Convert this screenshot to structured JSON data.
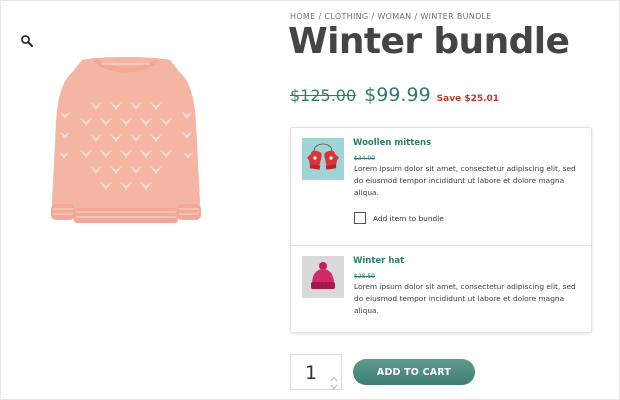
{
  "breadcrumb": {
    "items": [
      "HOME",
      "CLOTHING",
      "WOMAN",
      "WINTER BUNDLE"
    ],
    "separator": "/"
  },
  "product": {
    "title": "Winter bundle",
    "old_price": "$125.00",
    "price": "$99.99",
    "save_text": "Save $25.01",
    "image_icon": "sweater-image",
    "zoom_icon": "magnifier-icon"
  },
  "bundle": {
    "items": [
      {
        "name": "Woollen mittens",
        "old_price": "$34.00",
        "description": "Lorem ipsum dolor sit amet, consectetur adipiscing elit, sed do eiusmod tempor incididunt ut labore et dolore magna aliqua.",
        "add_label": "Add item to bundle",
        "checked": false,
        "thumb_icon": "mittens-image"
      },
      {
        "name": "Winter hat",
        "old_price": "$28.50",
        "description": "Lorem ipsum dolor sit amet, consectetur adipiscing elit, sed do eiusmod tempor incididunt ut labore et dolore magna aliqua.",
        "thumb_icon": "hat-image"
      }
    ]
  },
  "cart": {
    "quantity": "1",
    "button_label": "ADD TO CART"
  },
  "colors": {
    "accent": "#2f7c70",
    "save": "#c0392b",
    "button": "#4a8a7d",
    "sweater": "#f4b5a3"
  }
}
